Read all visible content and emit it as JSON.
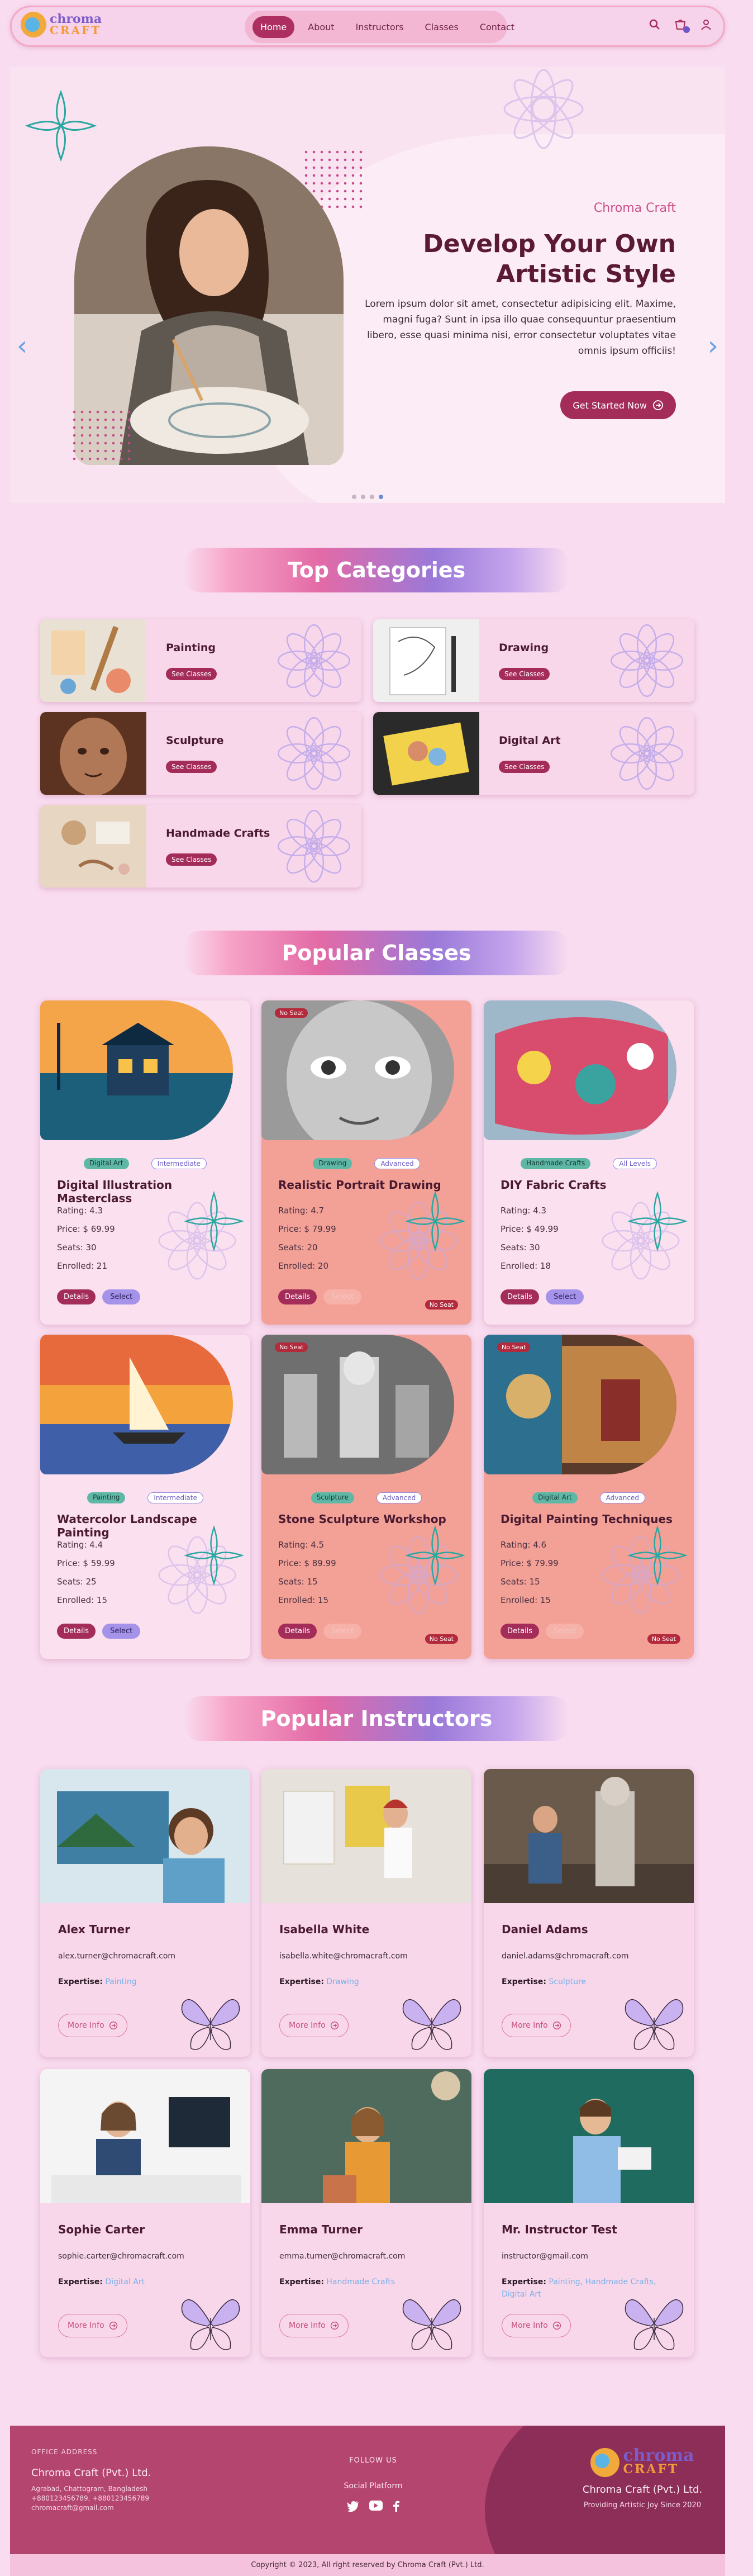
{
  "brand": {
    "line1": "chroma",
    "line2": "CRAFT"
  },
  "nav": {
    "items": [
      "Home",
      "About",
      "Instructors",
      "Classes",
      "Contact"
    ],
    "active": "Home"
  },
  "hero": {
    "subtitle": "Chroma Craft",
    "title": "Develop Your Own Artistic Style",
    "description": "Lorem ipsum dolor sit amet, consectetur adipisicing elit. Maxime, magni fuga? Sunt in ipsa illo quae consequuntur praesentium libero, esse quasi minima nisi, error consectetur voluptates vitae omnis ipsum officiis!",
    "cta": "Get Started Now",
    "slide_count": 4,
    "active_slide": 4
  },
  "categories_section": {
    "title": "Top Categories",
    "button_label": "See Classes",
    "items": [
      "Painting",
      "Drawing",
      "Sculpture",
      "Digital Art",
      "Handmade Crafts"
    ]
  },
  "classes_section": {
    "title": "Popular Classes",
    "details_label": "Details",
    "select_label": "Select",
    "no_seat_label": "No Seat",
    "items": [
      {
        "title": "Digital Illustration Masterclass",
        "category": "Digital Art",
        "level": "Intermediate",
        "rating": "Rating: 4.3",
        "price": "Price: $ 69.99",
        "seats": "Seats: 30",
        "enrolled": "Enrolled: 21",
        "full": false
      },
      {
        "title": "Realistic Portrait Drawing",
        "category": "Drawing",
        "level": "Advanced",
        "rating": "Rating: 4.7",
        "price": "Price: $ 79.99",
        "seats": "Seats: 20",
        "enrolled": "Enrolled: 20",
        "full": true
      },
      {
        "title": "DIY Fabric Crafts",
        "category": "Handmade Crafts",
        "level": "All Levels",
        "rating": "Rating: 4.3",
        "price": "Price: $ 49.99",
        "seats": "Seats: 30",
        "enrolled": "Enrolled: 18",
        "full": false
      },
      {
        "title": "Watercolor Landscape Painting",
        "category": "Painting",
        "level": "Intermediate",
        "rating": "Rating: 4.4",
        "price": "Price: $ 59.99",
        "seats": "Seats: 25",
        "enrolled": "Enrolled: 15",
        "full": false
      },
      {
        "title": "Stone Sculpture Workshop",
        "category": "Sculpture",
        "level": "Advanced",
        "rating": "Rating: 4.5",
        "price": "Price: $ 89.99",
        "seats": "Seats: 15",
        "enrolled": "Enrolled: 15",
        "full": true
      },
      {
        "title": "Digital Painting Techniques",
        "category": "Digital Art",
        "level": "Advanced",
        "rating": "Rating: 4.6",
        "price": "Price: $ 79.99",
        "seats": "Seats: 15",
        "enrolled": "Enrolled: 15",
        "full": true
      }
    ]
  },
  "instructors_section": {
    "title": "Popular Instructors",
    "expertise_label": "Expertise:",
    "more_label": "More Info",
    "items": [
      {
        "name": "Alex Turner",
        "email": "alex.turner@chromacraft.com",
        "expertise": "Painting"
      },
      {
        "name": "Isabella White",
        "email": "isabella.white@chromacraft.com",
        "expertise": "Drawing"
      },
      {
        "name": "Daniel Adams",
        "email": "daniel.adams@chromacraft.com",
        "expertise": "Sculpture"
      },
      {
        "name": "Sophie Carter",
        "email": "sophie.carter@chromacraft.com",
        "expertise": "Digital Art"
      },
      {
        "name": "Emma Turner",
        "email": "emma.turner@chromacraft.com",
        "expertise": "Handmade Crafts"
      },
      {
        "name": "Mr. Instructor Test",
        "email": "instructor@gmail.com",
        "expertise": "Painting, Handmade Crafts, Digital Art"
      }
    ]
  },
  "footer": {
    "office_label": "OFFICE ADDRESS",
    "company": "Chroma Craft (Pvt.) Ltd.",
    "address": "Agrabad, Chattogram, Bangladesh",
    "phones": "+880123456789, +880123456789",
    "email": "chromacraft@gmail.com",
    "follow_label": "FOLLOW US",
    "social_label": "Social Platform",
    "right_company": "Chroma Craft (Pvt.) Ltd.",
    "tagline": "Providing Artistic Joy Since 2020",
    "copyright": "Copyright © 2023, All right reserved by Chroma Craft (Pvt.) Ltd."
  },
  "colors": {
    "accent": "#a42c59",
    "page_bg": "#f9dcef",
    "full_card": "#f3a096",
    "footer": "#b4456f"
  }
}
